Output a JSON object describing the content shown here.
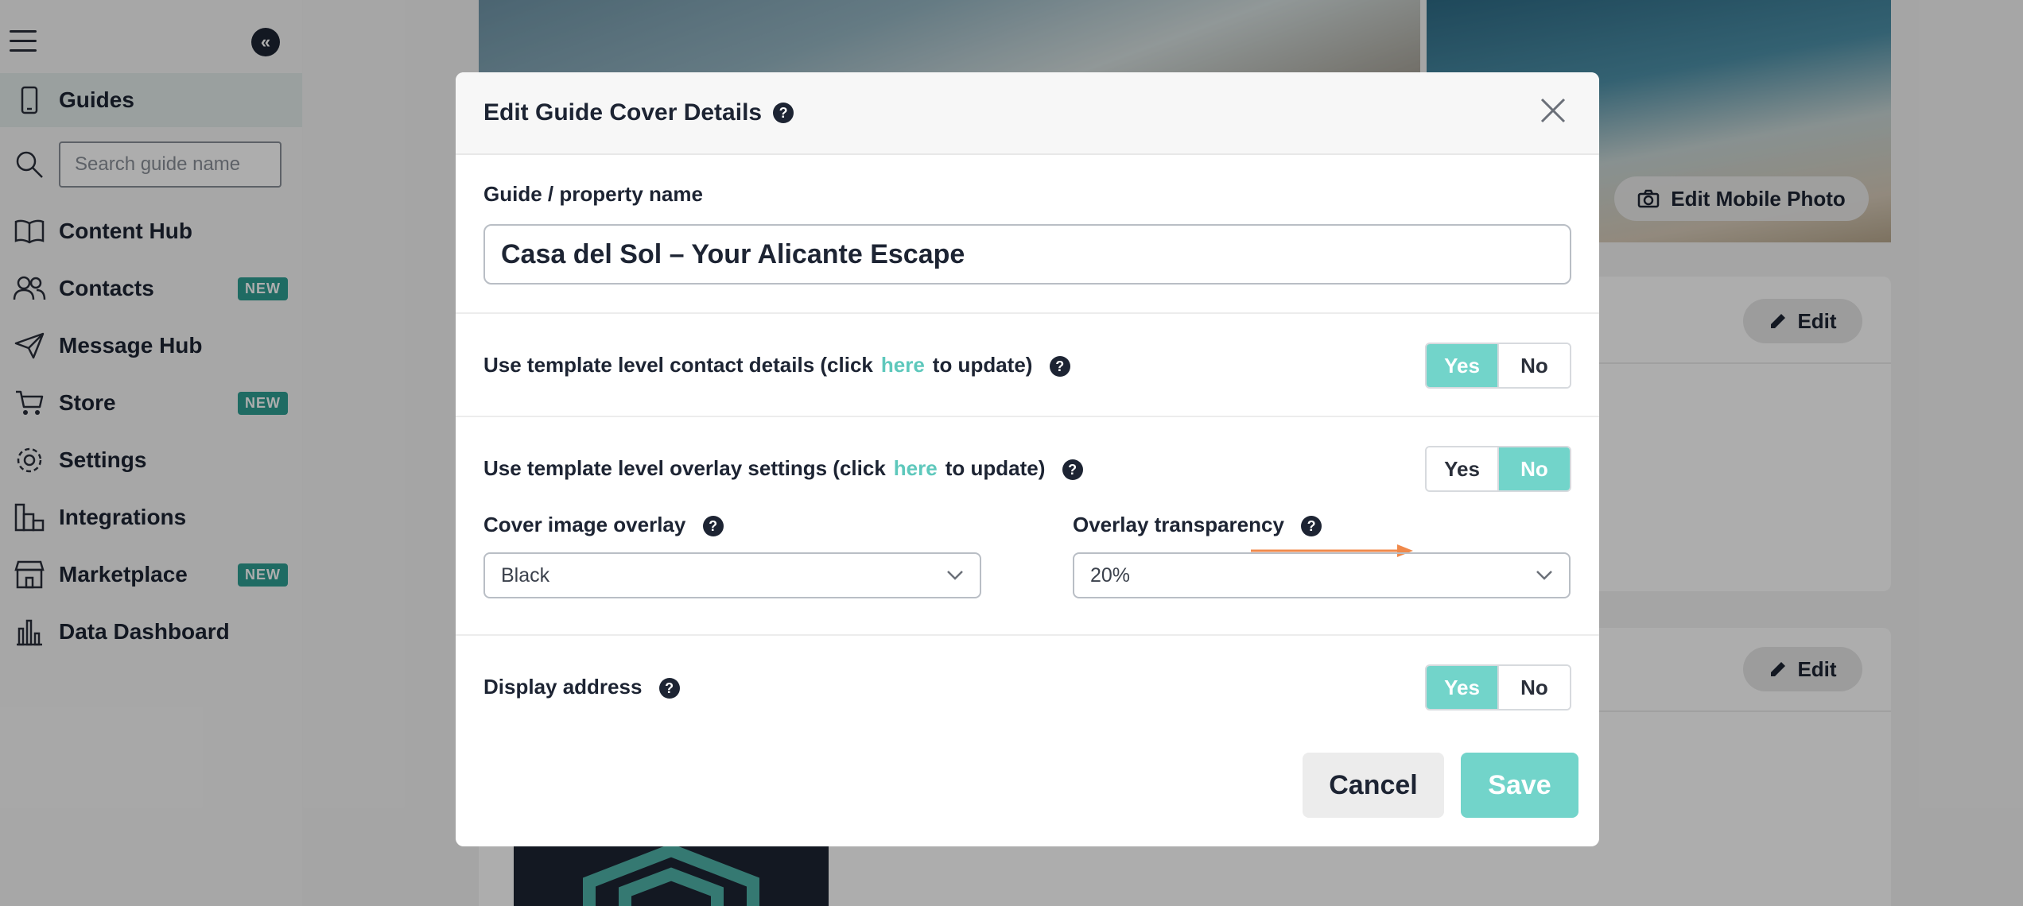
{
  "sidebar": {
    "search": {
      "placeholder": "Search guide name"
    },
    "items": [
      {
        "label": "Guides",
        "icon": "phone-icon",
        "badge": ""
      },
      {
        "label": "Content Hub",
        "icon": "book-icon",
        "badge": ""
      },
      {
        "label": "Contacts",
        "icon": "users-icon",
        "badge": "NEW"
      },
      {
        "label": "Message Hub",
        "icon": "send-icon",
        "badge": ""
      },
      {
        "label": "Store",
        "icon": "cart-icon",
        "badge": "NEW"
      },
      {
        "label": "Settings",
        "icon": "gear-icon",
        "badge": ""
      },
      {
        "label": "Integrations",
        "icon": "integrations-icon",
        "badge": ""
      },
      {
        "label": "Marketplace",
        "icon": "store-icon",
        "badge": "NEW"
      },
      {
        "label": "Data Dashboard",
        "icon": "chart-icon",
        "badge": ""
      }
    ]
  },
  "background": {
    "edit_mobile_photo": "Edit Mobile Photo",
    "edit_label": "Edit"
  },
  "modal": {
    "title": "Edit Guide Cover Details",
    "name_label": "Guide / property name",
    "name_value": "Casa del Sol – Your Alicante Escape",
    "contact": {
      "label_before": "Use template level contact details (click",
      "link": "here",
      "label_after": "to update)",
      "yes": "Yes",
      "no": "No",
      "selected": "Yes"
    },
    "overlay": {
      "label_before": "Use template level overlay settings (click",
      "link": "here",
      "label_after": "to update)",
      "yes": "Yes",
      "no": "No",
      "selected": "No",
      "cover_label": "Cover image overlay",
      "cover_value": "Black",
      "transparency_label": "Overlay transparency",
      "transparency_value": "20%"
    },
    "address": {
      "label": "Display address",
      "yes": "Yes",
      "no": "No",
      "selected": "Yes"
    },
    "cancel_label": "Cancel",
    "save_label": "Save"
  },
  "colors": {
    "accent": "#72d4ca",
    "badge": "#2f9e93",
    "arrow": "#f0894b",
    "dark": "#1d2433"
  }
}
